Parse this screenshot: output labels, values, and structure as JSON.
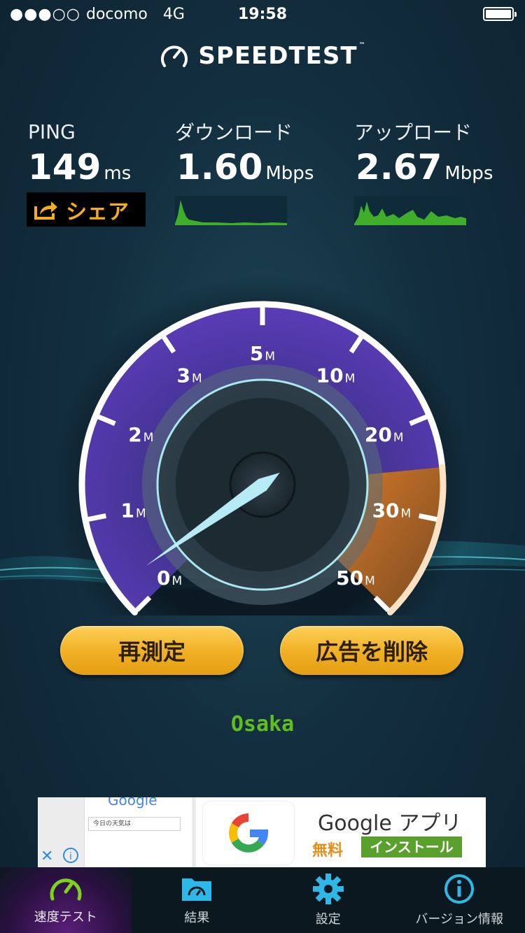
{
  "status_bar": {
    "signal": "●●●○○",
    "carrier": "docomo",
    "network": "4G",
    "time": "19:58"
  },
  "app": {
    "logo_text": "SPEEDTEST",
    "logo_tm": "™"
  },
  "stats": {
    "ping": {
      "label": "PING",
      "value": "149",
      "unit": "ms"
    },
    "download": {
      "label": "ダウンロード",
      "value": "1.60",
      "unit": "Mbps"
    },
    "upload": {
      "label": "アップロード",
      "value": "2.67",
      "unit": "Mbps"
    },
    "share_label": "シェア"
  },
  "gauge": {
    "ticks": [
      {
        "num": "0",
        "unit": "M"
      },
      {
        "num": "1",
        "unit": "M"
      },
      {
        "num": "2",
        "unit": "M"
      },
      {
        "num": "3",
        "unit": "M"
      },
      {
        "num": "5",
        "unit": "M"
      },
      {
        "num": "10",
        "unit": "M"
      },
      {
        "num": "20",
        "unit": "M"
      },
      {
        "num": "30",
        "unit": "M"
      },
      {
        "num": "50",
        "unit": "M"
      }
    ],
    "needle_value": 0.3,
    "colors": {
      "purple": "#6a3fc4",
      "orange": "#e8801c",
      "ring": "#ffffff"
    }
  },
  "buttons": {
    "retest": "再測定",
    "remove_ads": "広告を削除"
  },
  "server": "Osaka",
  "ad": {
    "title": "Google アプリ",
    "price": "無料",
    "install": "インストール",
    "screenshot_brand": "Google",
    "screenshot_search": "今日の天気は",
    "close_icon": "✕",
    "info_icon": "i"
  },
  "tabs": [
    {
      "label": "速度テスト",
      "icon": "speedometer-icon",
      "active": true
    },
    {
      "label": "結果",
      "icon": "results-folder-icon",
      "active": false
    },
    {
      "label": "設定",
      "icon": "gear-icon",
      "active": false
    },
    {
      "label": "バージョン情報",
      "icon": "info-icon",
      "active": false
    }
  ]
}
